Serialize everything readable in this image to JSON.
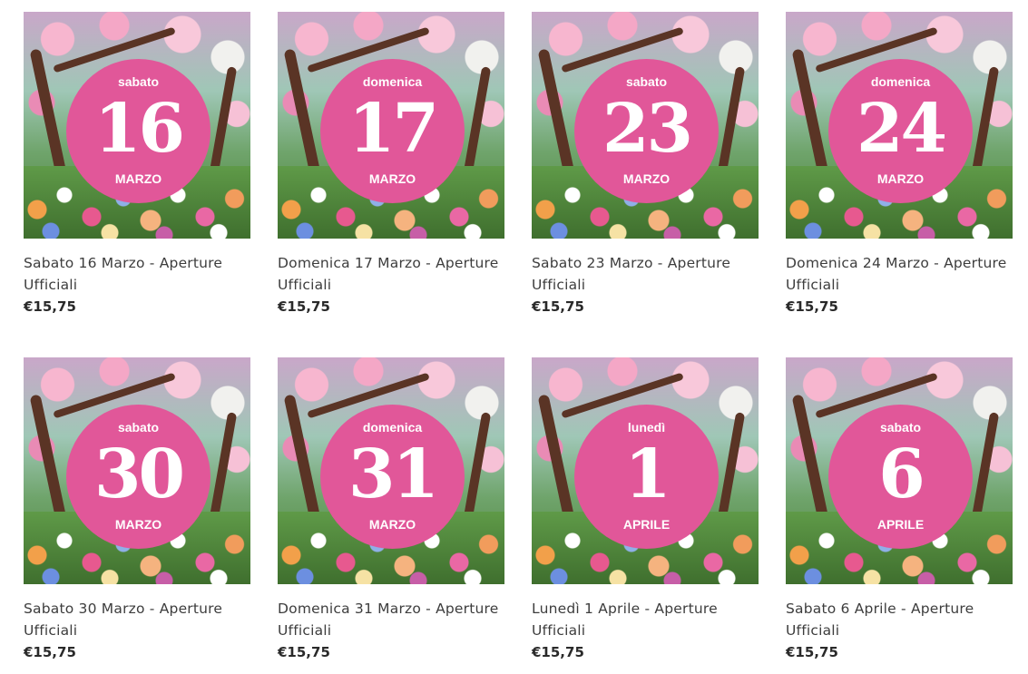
{
  "products": [
    {
      "weekday": "sabato",
      "day": "16",
      "month": "MARZO",
      "title_line1": "Sabato 16 Marzo - Aperture",
      "title_line2": "Ufficiali",
      "price": "€15,75"
    },
    {
      "weekday": "domenica",
      "day": "17",
      "month": "MARZO",
      "title_line1": "Domenica 17 Marzo - Aperture",
      "title_line2": "Ufficiali",
      "price": "€15,75"
    },
    {
      "weekday": "sabato",
      "day": "23",
      "month": "MARZO",
      "title_line1": "Sabato 23 Marzo - Aperture",
      "title_line2": "Ufficiali",
      "price": "€15,75"
    },
    {
      "weekday": "domenica",
      "day": "24",
      "month": "MARZO",
      "title_line1": "Domenica 24 Marzo - Aperture",
      "title_line2": "Ufficiali",
      "price": "€15,75"
    },
    {
      "weekday": "sabato",
      "day": "30",
      "month": "MARZO",
      "title_line1": "Sabato 30 Marzo - Aperture",
      "title_line2": "Ufficiali",
      "price": "€15,75"
    },
    {
      "weekday": "domenica",
      "day": "31",
      "month": "MARZO",
      "title_line1": "Domenica 31 Marzo - Aperture",
      "title_line2": "Ufficiali",
      "price": "€15,75"
    },
    {
      "weekday": "lunedì",
      "day": "1",
      "month": "APRILE",
      "title_line1": "Lunedì 1 Aprile - Aperture",
      "title_line2": "Ufficiali",
      "price": "€15,75"
    },
    {
      "weekday": "sabato",
      "day": "6",
      "month": "APRILE",
      "title_line1": "Sabato 6 Aprile - Aperture",
      "title_line2": "Ufficiali",
      "price": "€15,75"
    }
  ],
  "colors": {
    "badge": "#e15799",
    "title_text": "#3d3d3d",
    "price_text": "#2a2a2a"
  },
  "icons": {
    "product_image": "spring-garden-stained-glass-image"
  }
}
